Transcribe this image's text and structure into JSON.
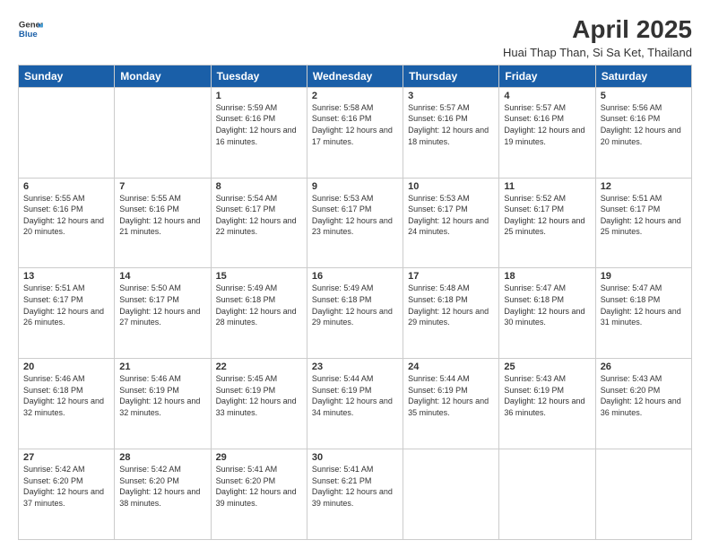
{
  "header": {
    "logo_line1": "General",
    "logo_line2": "Blue",
    "title": "April 2025",
    "subtitle": "Huai Thap Than, Si Sa Ket, Thailand"
  },
  "days_of_week": [
    "Sunday",
    "Monday",
    "Tuesday",
    "Wednesday",
    "Thursday",
    "Friday",
    "Saturday"
  ],
  "weeks": [
    [
      {
        "day": "",
        "info": ""
      },
      {
        "day": "",
        "info": ""
      },
      {
        "day": "1",
        "info": "Sunrise: 5:59 AM\nSunset: 6:16 PM\nDaylight: 12 hours and 16 minutes."
      },
      {
        "day": "2",
        "info": "Sunrise: 5:58 AM\nSunset: 6:16 PM\nDaylight: 12 hours and 17 minutes."
      },
      {
        "day": "3",
        "info": "Sunrise: 5:57 AM\nSunset: 6:16 PM\nDaylight: 12 hours and 18 minutes."
      },
      {
        "day": "4",
        "info": "Sunrise: 5:57 AM\nSunset: 6:16 PM\nDaylight: 12 hours and 19 minutes."
      },
      {
        "day": "5",
        "info": "Sunrise: 5:56 AM\nSunset: 6:16 PM\nDaylight: 12 hours and 20 minutes."
      }
    ],
    [
      {
        "day": "6",
        "info": "Sunrise: 5:55 AM\nSunset: 6:16 PM\nDaylight: 12 hours and 20 minutes."
      },
      {
        "day": "7",
        "info": "Sunrise: 5:55 AM\nSunset: 6:16 PM\nDaylight: 12 hours and 21 minutes."
      },
      {
        "day": "8",
        "info": "Sunrise: 5:54 AM\nSunset: 6:17 PM\nDaylight: 12 hours and 22 minutes."
      },
      {
        "day": "9",
        "info": "Sunrise: 5:53 AM\nSunset: 6:17 PM\nDaylight: 12 hours and 23 minutes."
      },
      {
        "day": "10",
        "info": "Sunrise: 5:53 AM\nSunset: 6:17 PM\nDaylight: 12 hours and 24 minutes."
      },
      {
        "day": "11",
        "info": "Sunrise: 5:52 AM\nSunset: 6:17 PM\nDaylight: 12 hours and 25 minutes."
      },
      {
        "day": "12",
        "info": "Sunrise: 5:51 AM\nSunset: 6:17 PM\nDaylight: 12 hours and 25 minutes."
      }
    ],
    [
      {
        "day": "13",
        "info": "Sunrise: 5:51 AM\nSunset: 6:17 PM\nDaylight: 12 hours and 26 minutes."
      },
      {
        "day": "14",
        "info": "Sunrise: 5:50 AM\nSunset: 6:17 PM\nDaylight: 12 hours and 27 minutes."
      },
      {
        "day": "15",
        "info": "Sunrise: 5:49 AM\nSunset: 6:18 PM\nDaylight: 12 hours and 28 minutes."
      },
      {
        "day": "16",
        "info": "Sunrise: 5:49 AM\nSunset: 6:18 PM\nDaylight: 12 hours and 29 minutes."
      },
      {
        "day": "17",
        "info": "Sunrise: 5:48 AM\nSunset: 6:18 PM\nDaylight: 12 hours and 29 minutes."
      },
      {
        "day": "18",
        "info": "Sunrise: 5:47 AM\nSunset: 6:18 PM\nDaylight: 12 hours and 30 minutes."
      },
      {
        "day": "19",
        "info": "Sunrise: 5:47 AM\nSunset: 6:18 PM\nDaylight: 12 hours and 31 minutes."
      }
    ],
    [
      {
        "day": "20",
        "info": "Sunrise: 5:46 AM\nSunset: 6:18 PM\nDaylight: 12 hours and 32 minutes."
      },
      {
        "day": "21",
        "info": "Sunrise: 5:46 AM\nSunset: 6:19 PM\nDaylight: 12 hours and 32 minutes."
      },
      {
        "day": "22",
        "info": "Sunrise: 5:45 AM\nSunset: 6:19 PM\nDaylight: 12 hours and 33 minutes."
      },
      {
        "day": "23",
        "info": "Sunrise: 5:44 AM\nSunset: 6:19 PM\nDaylight: 12 hours and 34 minutes."
      },
      {
        "day": "24",
        "info": "Sunrise: 5:44 AM\nSunset: 6:19 PM\nDaylight: 12 hours and 35 minutes."
      },
      {
        "day": "25",
        "info": "Sunrise: 5:43 AM\nSunset: 6:19 PM\nDaylight: 12 hours and 36 minutes."
      },
      {
        "day": "26",
        "info": "Sunrise: 5:43 AM\nSunset: 6:20 PM\nDaylight: 12 hours and 36 minutes."
      }
    ],
    [
      {
        "day": "27",
        "info": "Sunrise: 5:42 AM\nSunset: 6:20 PM\nDaylight: 12 hours and 37 minutes."
      },
      {
        "day": "28",
        "info": "Sunrise: 5:42 AM\nSunset: 6:20 PM\nDaylight: 12 hours and 38 minutes."
      },
      {
        "day": "29",
        "info": "Sunrise: 5:41 AM\nSunset: 6:20 PM\nDaylight: 12 hours and 39 minutes."
      },
      {
        "day": "30",
        "info": "Sunrise: 5:41 AM\nSunset: 6:21 PM\nDaylight: 12 hours and 39 minutes."
      },
      {
        "day": "",
        "info": ""
      },
      {
        "day": "",
        "info": ""
      },
      {
        "day": "",
        "info": ""
      }
    ]
  ]
}
